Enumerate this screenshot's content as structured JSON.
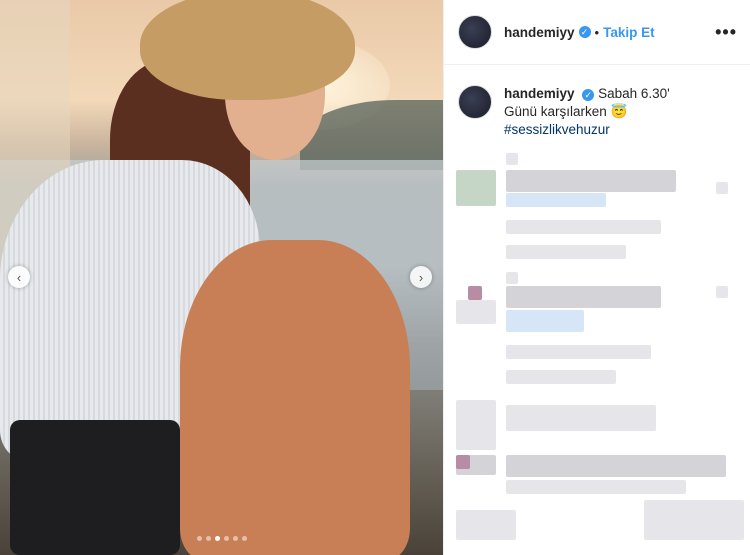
{
  "post": {
    "slide_count": 6,
    "active_slide": 3,
    "prev_icon": "chevron-left-icon",
    "next_icon": "chevron-right-icon"
  },
  "header": {
    "username": "handemiyy",
    "separator": "•",
    "follow_label": "Takip Et",
    "more_label": "•••",
    "verified_icon": "verified-badge-icon"
  },
  "caption": {
    "username": "handemiyy",
    "line1": "Sabah 6.30'",
    "line2": "Günü karşılarken 😇",
    "hashtag": "#sessizlikvehuzur"
  },
  "colors": {
    "accent": "#3897f0",
    "hashtag": "#003569"
  }
}
